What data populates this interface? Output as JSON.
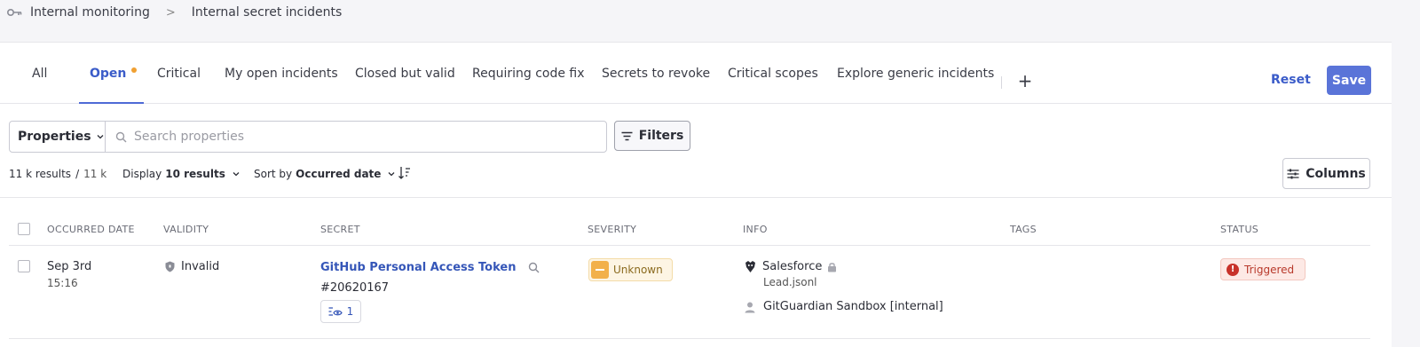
{
  "breadcrumb": {
    "icon": "key-icon",
    "items": [
      "Internal monitoring",
      "Internal secret incidents"
    ],
    "separator": ">"
  },
  "tabs": {
    "items": [
      {
        "label": "All"
      },
      {
        "label": "Open",
        "active": true,
        "unsaved_dot_color": "#f0a032"
      },
      {
        "label": "Critical"
      },
      {
        "label": "My open incidents"
      },
      {
        "label": "Closed but valid"
      },
      {
        "label": "Requiring code fix"
      },
      {
        "label": "Secrets to revoke"
      },
      {
        "label": "Critical scopes"
      },
      {
        "label": "Explore generic incidents"
      }
    ],
    "add_label": "+",
    "reset_label": "Reset",
    "save_label": "Save"
  },
  "search": {
    "properties_label": "Properties",
    "placeholder": "Search properties",
    "filters_label": "Filters"
  },
  "results": {
    "count": "11 k results",
    "separator": "/",
    "total": "11 k",
    "display_label": "Display",
    "display_value": "10 results",
    "sort_label": "Sort by",
    "sort_value": "Occurred date",
    "columns_label": "Columns"
  },
  "table": {
    "headers": [
      "OCCURRED DATE",
      "VALIDITY",
      "SECRET",
      "SEVERITY",
      "INFO",
      "TAGS",
      "STATUS"
    ],
    "rows": [
      {
        "date": "Sep 3rd",
        "time": "15:16",
        "validity": "Invalid",
        "secret_name": "GitHub Personal Access Token",
        "secret_id": "#20620167",
        "occurrences": "1",
        "severity": "Unknown",
        "info_source": "Salesforce",
        "info_file": "Lead.jsonl",
        "info_member": "GitGuardian Sandbox [internal]",
        "tags": "",
        "status": "Triggered"
      }
    ]
  },
  "colors": {
    "accent": "#5a74d8",
    "link": "#3556b8",
    "severity_unknown": "#f2b04a",
    "status_triggered": "#c8322a"
  }
}
